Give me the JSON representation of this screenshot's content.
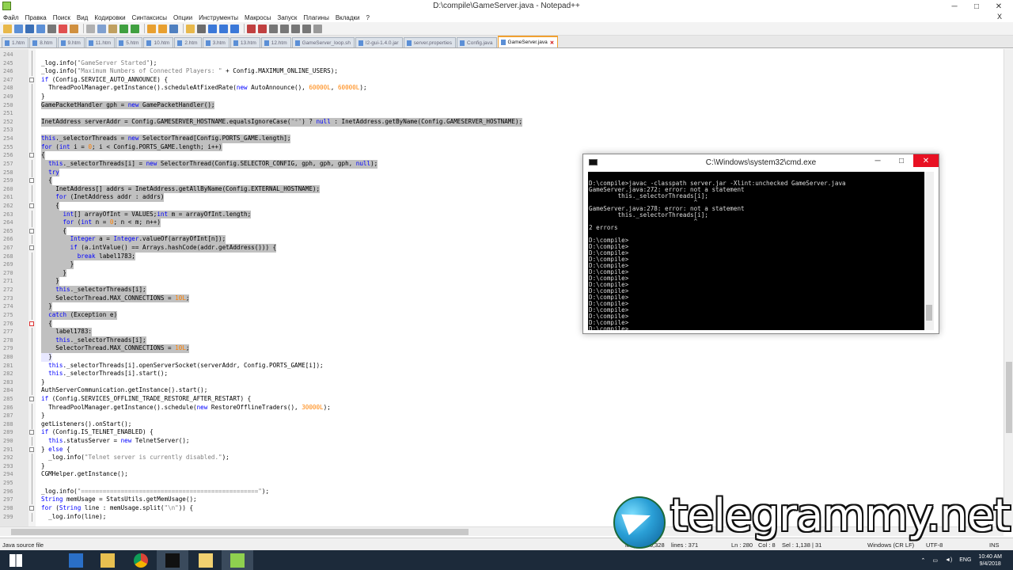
{
  "window": {
    "title": "D:\\compile\\GameServer.java - Notepad++",
    "min": "─",
    "max": "□",
    "close": "✕"
  },
  "menu": [
    "Файл",
    "Правка",
    "Поиск",
    "Вид",
    "Кодировки",
    "Синтаксисы",
    "Опции",
    "Инструменты",
    "Макросы",
    "Запуск",
    "Плагины",
    "Вкладки",
    "?"
  ],
  "menu_close": "X",
  "toolbar_colors": [
    "#e8b84a",
    "#5b8fd6",
    "#3b6fb6",
    "#5b8fd6",
    "#777",
    "#e05050",
    "#d09040",
    "#b0b0b0",
    "#7fa0d0",
    "#c0a060",
    "#40a040",
    "#40a040",
    "#e8a030",
    "#e8a030",
    "#5080c0",
    "#e8b84a",
    "#6c6c6c",
    "#3b78d8",
    "#3b78d8",
    "#3b78d8",
    "#c04040",
    "#c04040",
    "#777",
    "#777",
    "#777",
    "#777",
    "#999"
  ],
  "tabs": [
    {
      "label": "1.htm"
    },
    {
      "label": "8.htm"
    },
    {
      "label": "9.htm"
    },
    {
      "label": "11.htm"
    },
    {
      "label": "5.htm"
    },
    {
      "label": "10.htm"
    },
    {
      "label": "2.htm"
    },
    {
      "label": "3.htm"
    },
    {
      "label": "13.htm"
    },
    {
      "label": "12.htm"
    },
    {
      "label": "GameServer_loop.sh"
    },
    {
      "label": "l2-gui-1.4.0.jar"
    },
    {
      "label": "server.properties"
    },
    {
      "label": "Config.java"
    },
    {
      "label": "GameServer.java",
      "active": true
    }
  ],
  "code_lines": [
    {
      "n": "244",
      "t": "",
      "s": "",
      "f": "v"
    },
    {
      "n": "245",
      "t": "_log.info(\"GameServer Started\");",
      "s": "",
      "f": "v"
    },
    {
      "n": "246",
      "t": "_log.info(\"Maximum Numbers of Connected Players: \" + Config.MAXIMUM_ONLINE_USERS);",
      "s": "",
      "f": "v"
    },
    {
      "n": "247",
      "t": "if (Config.SERVICE_AUTO_ANNOUNCE) {",
      "s": "",
      "f": "m"
    },
    {
      "n": "248",
      "t": "  ThreadPoolManager.getInstance().scheduleAtFixedRate(new AutoAnnounce(), 60000L, 60000L);",
      "s": "",
      "f": "v"
    },
    {
      "n": "249",
      "t": "}",
      "s": "",
      "f": "v"
    },
    {
      "n": "250",
      "t": "GamePacketHandler gph = new GamePacketHandler();",
      "s": "sel",
      "f": "v"
    },
    {
      "n": "251",
      "t": "",
      "s": "sel",
      "f": "v"
    },
    {
      "n": "252",
      "t": "InetAddress serverAddr = Config.GAMESERVER_HOSTNAME.equalsIgnoreCase(\"*\") ? null : InetAddress.getByName(Config.GAMESERVER_HOSTNAME);",
      "s": "sel",
      "f": "v"
    },
    {
      "n": "253",
      "t": "",
      "s": "sel",
      "f": "v"
    },
    {
      "n": "254",
      "t": "this._selectorThreads = new SelectorThread[Config.PORTS_GAME.length];",
      "s": "sel",
      "f": "v"
    },
    {
      "n": "255",
      "t": "for (int i = 0; i < Config.PORTS_GAME.length; i++)",
      "s": "sel",
      "f": "v"
    },
    {
      "n": "256",
      "t": "{",
      "s": "sel",
      "f": "m"
    },
    {
      "n": "257",
      "t": "  this._selectorThreads[i] = new SelectorThread(Config.SELECTOR_CONFIG, gph, gph, gph, null);",
      "s": "sel",
      "f": "v"
    },
    {
      "n": "258",
      "t": "  try",
      "s": "sel",
      "f": "v"
    },
    {
      "n": "259",
      "t": "  {",
      "s": "sel",
      "f": "m"
    },
    {
      "n": "260",
      "t": "    InetAddress[] addrs = InetAddress.getAllByName(Config.EXTERNAL_HOSTNAME);",
      "s": "sel",
      "f": "v"
    },
    {
      "n": "261",
      "t": "    for (InetAddress addr : addrs)",
      "s": "sel",
      "f": "v"
    },
    {
      "n": "262",
      "t": "    {",
      "s": "sel",
      "f": "m"
    },
    {
      "n": "263",
      "t": "      int[] arrayOfInt = VALUES;int m = arrayOfInt.length;",
      "s": "sel",
      "f": "v"
    },
    {
      "n": "264",
      "t": "      for (int n = 0; n < m; n++)",
      "s": "sel",
      "f": "v"
    },
    {
      "n": "265",
      "t": "      {",
      "s": "sel",
      "f": "m"
    },
    {
      "n": "266",
      "t": "        Integer a = Integer.valueOf(arrayOfInt[n]);",
      "s": "sel",
      "f": "v"
    },
    {
      "n": "267",
      "t": "        if (a.intValue() == Arrays.hashCode(addr.getAddress())) {",
      "s": "sel",
      "f": "m"
    },
    {
      "n": "268",
      "t": "          break label1783;",
      "s": "sel",
      "f": "v"
    },
    {
      "n": "269",
      "t": "        }",
      "s": "sel",
      "f": "v"
    },
    {
      "n": "270",
      "t": "      }",
      "s": "sel",
      "f": "v"
    },
    {
      "n": "271",
      "t": "    }",
      "s": "sel",
      "f": "v"
    },
    {
      "n": "272",
      "t": "    this._selectorThreads[i];",
      "s": "sel",
      "f": "v"
    },
    {
      "n": "273",
      "t": "    SelectorThread.MAX_CONNECTIONS = 10L;",
      "s": "sel",
      "f": "v"
    },
    {
      "n": "274",
      "t": "  }",
      "s": "sel",
      "f": "v"
    },
    {
      "n": "275",
      "t": "  catch (Exception e)",
      "s": "sel",
      "f": "v"
    },
    {
      "n": "276",
      "t": "  {",
      "s": "sel",
      "f": "red"
    },
    {
      "n": "277",
      "t": "    label1783:",
      "s": "sel",
      "f": "v"
    },
    {
      "n": "278",
      "t": "    this._selectorThreads[i];",
      "s": "sel",
      "f": "v"
    },
    {
      "n": "279",
      "t": "    SelectorThread.MAX_CONNECTIONS = 10L;",
      "s": "sel",
      "f": "v"
    },
    {
      "n": "280",
      "t": "  }",
      "s": "cur",
      "f": "v"
    },
    {
      "n": "281",
      "t": "  this._selectorThreads[i].openServerSocket(serverAddr, Config.PORTS_GAME[i]);",
      "s": "",
      "f": "v"
    },
    {
      "n": "282",
      "t": "  this._selectorThreads[i].start();",
      "s": "",
      "f": "v"
    },
    {
      "n": "283",
      "t": "}",
      "s": "",
      "f": "v"
    },
    {
      "n": "284",
      "t": "AuthServerCommunication.getInstance().start();",
      "s": "",
      "f": "v"
    },
    {
      "n": "285",
      "t": "if (Config.SERVICES_OFFLINE_TRADE_RESTORE_AFTER_RESTART) {",
      "s": "",
      "f": "m"
    },
    {
      "n": "286",
      "t": "  ThreadPoolManager.getInstance().schedule(new RestoreOfflineTraders(), 30000L);",
      "s": "",
      "f": "v"
    },
    {
      "n": "287",
      "t": "}",
      "s": "",
      "f": "v"
    },
    {
      "n": "288",
      "t": "getListeners().onStart();",
      "s": "",
      "f": "v"
    },
    {
      "n": "289",
      "t": "if (Config.IS_TELNET_ENABLED) {",
      "s": "",
      "f": "m"
    },
    {
      "n": "290",
      "t": "  this.statusServer = new TelnetServer();",
      "s": "",
      "f": "v"
    },
    {
      "n": "291",
      "t": "} else {",
      "s": "",
      "f": "m"
    },
    {
      "n": "292",
      "t": "  _log.info(\"Telnet server is currently disabled.\");",
      "s": "",
      "f": "v"
    },
    {
      "n": "293",
      "t": "}",
      "s": "",
      "f": "v"
    },
    {
      "n": "294",
      "t": "CGMHelper.getInstance();",
      "s": "",
      "f": "v"
    },
    {
      "n": "295",
      "t": "",
      "s": "",
      "f": "v"
    },
    {
      "n": "296",
      "t": "_log.info(\"=================================================\");",
      "s": "",
      "f": "v"
    },
    {
      "n": "297",
      "t": "String memUsage = StatsUtils.getMemUsage();",
      "s": "",
      "f": "v"
    },
    {
      "n": "298",
      "t": "for (String line : memUsage.split(\"\\n\")) {",
      "s": "",
      "f": "m"
    },
    {
      "n": "299",
      "t": "  _log.info(line);",
      "s": "",
      "f": "v"
    }
  ],
  "cmd": {
    "title": "C:\\Windows\\system32\\cmd.exe",
    "min": "─",
    "max": "□",
    "close": "✕",
    "lines": [
      "",
      "D:\\compile>javac -classpath server.jar -Xlint:unchecked GameServer.java",
      "GameServer.java:272: error: not a statement",
      "        this._selectorThreads[i];",
      "                             ^",
      "GameServer.java:278: error: not a statement",
      "        this._selectorThreads[i];",
      "                             ^",
      "2 errors",
      "",
      "D:\\compile>",
      "D:\\compile>",
      "D:\\compile>",
      "D:\\compile>",
      "D:\\compile>",
      "D:\\compile>",
      "D:\\compile>",
      "D:\\compile>",
      "D:\\compile>",
      "D:\\compile>",
      "D:\\compile>",
      "D:\\compile>",
      "D:\\compile>",
      "D:\\compile>",
      "D:\\compile>_"
    ]
  },
  "status": {
    "filetype": "Java source file",
    "length": "length : 16,328",
    "lines": "lines : 371",
    "ln": "Ln : 280",
    "col": "Col : 8",
    "sel": "Sel : 1,138 | 31",
    "eol": "Windows (CR LF)",
    "enc": "UTF-8",
    "mode": "INS"
  },
  "watermark": "telegrammy.net",
  "taskbar": {
    "apps": [
      {
        "name": "start",
        "color": "#ffffff"
      },
      {
        "name": "powershell",
        "color": "#2a6fc7"
      },
      {
        "name": "file-explorer",
        "color": "#e8c050"
      },
      {
        "name": "chrome",
        "color": "#3aaa4a"
      },
      {
        "name": "cmd",
        "color": "#111111",
        "active": true
      },
      {
        "name": "folder",
        "color": "#f0d070"
      },
      {
        "name": "notepadpp",
        "color": "#8fd14f",
        "active": true
      }
    ],
    "lang": "ENG",
    "time": "10:40 AM",
    "date": "9/4/2018"
  }
}
